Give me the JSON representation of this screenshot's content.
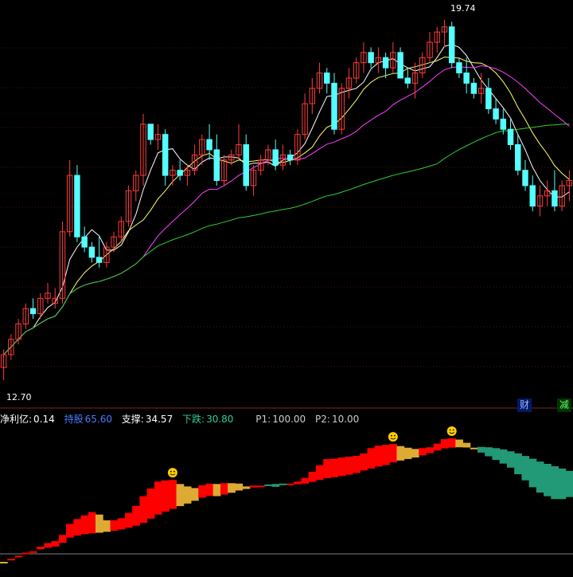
{
  "price_high_label": "19.74",
  "price_low_label": "12.70",
  "indicator": {
    "net_label": "净利亿:",
    "net_value": "0.14",
    "hold_label": "持股",
    "hold_value": "65.60",
    "support_label": "支撑:",
    "support_value": "34.57",
    "fall_label": "下跌:",
    "fall_value": "30.80",
    "p1_label": "P1:",
    "p1_value": "100.00",
    "p2_label": "P2:",
    "p2_value": "10.00"
  },
  "badges": {
    "fin": "财",
    "reduce": "减"
  },
  "colors": {
    "up": "#ff3b3b",
    "down": "#54ffff",
    "ma5": "#ffffff",
    "ma10": "#ffff66",
    "ma20": "#ff40ff",
    "ma60": "#33cc33",
    "red_band": "#ff0000",
    "gold_band": "#ddaa33",
    "teal_band": "#229977"
  },
  "chart_data": {
    "type": "candlestick",
    "ohlc": [
      [
        12.95,
        13.3,
        12.7,
        13.2
      ],
      [
        13.2,
        13.6,
        13.1,
        13.5
      ],
      [
        13.5,
        13.9,
        13.4,
        13.8
      ],
      [
        13.8,
        14.2,
        13.7,
        14.1
      ],
      [
        14.1,
        14.3,
        13.9,
        14.0
      ],
      [
        14.0,
        14.4,
        13.9,
        14.3
      ],
      [
        14.3,
        14.6,
        14.2,
        14.4
      ],
      [
        14.2,
        14.5,
        14.1,
        14.3
      ],
      [
        14.3,
        15.8,
        14.2,
        15.6
      ],
      [
        15.6,
        17.0,
        15.5,
        16.7
      ],
      [
        16.7,
        16.9,
        15.4,
        15.5
      ],
      [
        15.5,
        15.7,
        15.2,
        15.3
      ],
      [
        15.3,
        15.4,
        15.0,
        15.1
      ],
      [
        15.1,
        15.5,
        14.9,
        15.0
      ],
      [
        15.0,
        15.4,
        14.9,
        15.3
      ],
      [
        15.3,
        15.6,
        15.2,
        15.5
      ],
      [
        15.5,
        15.9,
        15.4,
        15.8
      ],
      [
        15.8,
        16.5,
        15.7,
        16.4
      ],
      [
        16.4,
        16.8,
        16.2,
        16.7
      ],
      [
        16.7,
        17.9,
        16.5,
        17.7
      ],
      [
        17.7,
        17.7,
        17.3,
        17.4
      ],
      [
        17.4,
        17.7,
        17.2,
        17.5
      ],
      [
        17.5,
        17.6,
        16.5,
        16.7
      ],
      [
        16.7,
        16.9,
        16.5,
        16.8
      ],
      [
        16.8,
        17.0,
        16.6,
        16.7
      ],
      [
        16.7,
        16.9,
        16.5,
        16.8
      ],
      [
        16.8,
        17.3,
        16.7,
        17.1
      ],
      [
        17.1,
        17.5,
        16.9,
        17.4
      ],
      [
        17.4,
        17.7,
        17.0,
        17.2
      ],
      [
        17.2,
        17.5,
        16.5,
        16.6
      ],
      [
        16.6,
        17.1,
        16.5,
        17.0
      ],
      [
        17.0,
        17.2,
        16.9,
        17.1
      ],
      [
        17.1,
        17.7,
        17.0,
        17.3
      ],
      [
        17.3,
        17.5,
        16.4,
        16.5
      ],
      [
        16.5,
        16.9,
        16.3,
        16.8
      ],
      [
        16.8,
        17.1,
        16.7,
        17.0
      ],
      [
        17.0,
        17.3,
        16.9,
        17.2
      ],
      [
        17.2,
        17.4,
        16.8,
        16.9
      ],
      [
        16.9,
        17.3,
        16.8,
        17.1
      ],
      [
        17.1,
        17.2,
        16.9,
        17.0
      ],
      [
        17.0,
        17.6,
        16.9,
        17.5
      ],
      [
        17.5,
        18.3,
        17.4,
        18.1
      ],
      [
        18.1,
        18.6,
        17.9,
        18.4
      ],
      [
        18.4,
        18.9,
        18.3,
        18.7
      ],
      [
        18.7,
        18.8,
        18.3,
        18.5
      ],
      [
        18.5,
        18.7,
        17.5,
        17.6
      ],
      [
        17.6,
        18.5,
        17.5,
        18.4
      ],
      [
        18.4,
        18.8,
        18.2,
        18.6
      ],
      [
        18.6,
        19.0,
        18.5,
        18.9
      ],
      [
        18.9,
        19.3,
        18.7,
        19.1
      ],
      [
        19.1,
        19.2,
        18.8,
        18.9
      ],
      [
        18.9,
        19.2,
        18.7,
        19.0
      ],
      [
        19.0,
        19.1,
        18.6,
        18.8
      ],
      [
        18.8,
        19.3,
        18.7,
        19.1
      ],
      [
        19.1,
        19.2,
        18.7,
        18.6
      ],
      [
        18.6,
        18.8,
        18.4,
        18.5
      ],
      [
        18.5,
        18.9,
        18.2,
        18.7
      ],
      [
        18.7,
        19.1,
        18.6,
        19.0
      ],
      [
        19.0,
        19.5,
        18.9,
        19.3
      ],
      [
        19.3,
        19.6,
        19.1,
        19.5
      ],
      [
        19.5,
        19.74,
        19.2,
        19.6
      ],
      [
        19.6,
        19.7,
        18.8,
        18.9
      ],
      [
        18.9,
        19.0,
        18.6,
        18.7
      ],
      [
        18.7,
        19.0,
        18.3,
        18.5
      ],
      [
        18.5,
        18.6,
        18.2,
        18.3
      ],
      [
        18.3,
        18.7,
        18.1,
        18.4
      ],
      [
        18.4,
        18.6,
        17.9,
        18.0
      ],
      [
        18.0,
        18.2,
        17.7,
        17.8
      ],
      [
        17.8,
        18.0,
        17.5,
        17.6
      ],
      [
        17.6,
        17.8,
        17.2,
        17.3
      ],
      [
        17.3,
        17.5,
        16.7,
        16.8
      ],
      [
        16.8,
        17.0,
        16.4,
        16.5
      ],
      [
        16.5,
        16.7,
        16.0,
        16.1
      ],
      [
        16.1,
        16.5,
        15.9,
        16.3
      ],
      [
        16.3,
        16.6,
        16.1,
        16.4
      ],
      [
        16.4,
        16.8,
        16.0,
        16.1
      ],
      [
        16.1,
        16.6,
        16.0,
        16.5
      ],
      [
        16.5,
        16.8,
        16.2,
        16.6
      ]
    ],
    "price_range": [
      12.5,
      20.0
    ],
    "ma_series": [
      "MA5",
      "MA10",
      "MA20",
      "MA60"
    ],
    "indicator_markers": [
      0.96,
      0.96,
      0.98
    ]
  }
}
